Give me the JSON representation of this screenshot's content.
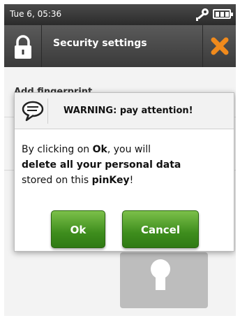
{
  "status_bar": {
    "time": "Tue 6, 05:36",
    "icons": [
      "key-icon",
      "battery-icon"
    ]
  },
  "title_bar": {
    "title": "Security settings",
    "left_icon": "lock-icon",
    "right_icon": "close-x-icon",
    "close_color": "#f08a1c"
  },
  "background": {
    "first_item": "Add fingerprint"
  },
  "dialog": {
    "icon": "speech-bubble-icon",
    "title": "WARNING: pay attention!",
    "message_parts": {
      "p1": "By clicking on ",
      "p2": "Ok",
      "p3": ", you will ",
      "p4": "delete all your personal data",
      "p5": " stored on this ",
      "p6": "pinKey",
      "p7": "!"
    },
    "ok_label": "Ok",
    "cancel_label": "Cancel"
  },
  "colors": {
    "button_green": "#3e8d1d",
    "header_dark": "#3a3a3a"
  }
}
